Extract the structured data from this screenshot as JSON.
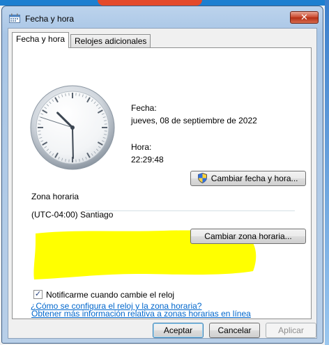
{
  "window": {
    "title": "Fecha y hora",
    "close_glyph": "✕"
  },
  "tabs": [
    {
      "label": "Fecha y hora",
      "active": true
    },
    {
      "label": "Relojes adicionales",
      "active": false
    }
  ],
  "datetime": {
    "date_label": "Fecha:",
    "date_value": "jueves, 08 de septiembre de 2022",
    "time_label": "Hora:",
    "time_value": "22:29:48",
    "change_button": "Cambiar fecha y hora..."
  },
  "clock": {
    "hours": 22,
    "minutes": 29,
    "seconds": 48
  },
  "timezone": {
    "section_label": "Zona horaria",
    "value": "(UTC-04:00) Santiago",
    "change_button": "Cambiar zona horaria..."
  },
  "notify": {
    "label": "Notificarme cuando cambie el reloj",
    "checked": true,
    "check_glyph": "✓"
  },
  "links": {
    "more_info": "Obtener más información relativa a zonas horarias en línea",
    "howto": "¿Cómo se configura el reloj y la zona horaria?"
  },
  "footer": {
    "accept": "Aceptar",
    "cancel": "Cancelar",
    "apply": "Aplicar"
  },
  "colors": {
    "highlight": "#ffff00",
    "link": "#0066cc",
    "close_button": "#c9462b"
  }
}
